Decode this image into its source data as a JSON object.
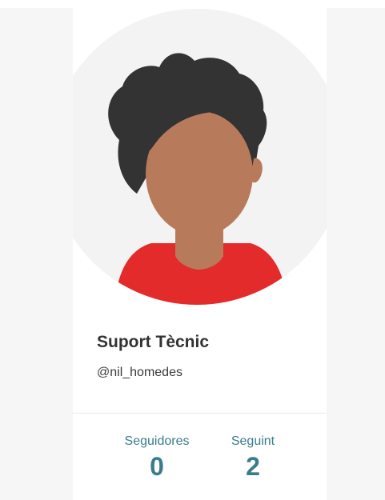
{
  "profile": {
    "name": "Suport Tècnic",
    "handle": "@nil_homedes",
    "avatar": {
      "icon": "user-avatar-illustration",
      "colors": {
        "background": "#f3f3f3",
        "hair": "#333333",
        "skin": "#b77b5c",
        "shirt": "#e32b2b"
      }
    }
  },
  "stats": {
    "followers_label": "Seguidores",
    "followers_count": "0",
    "following_label": "Seguint",
    "following_count": "2"
  },
  "colors": {
    "accent": "#3a7b8c",
    "text": "#333333",
    "page_background": "#f6f6f6",
    "card_background": "#ffffff"
  }
}
